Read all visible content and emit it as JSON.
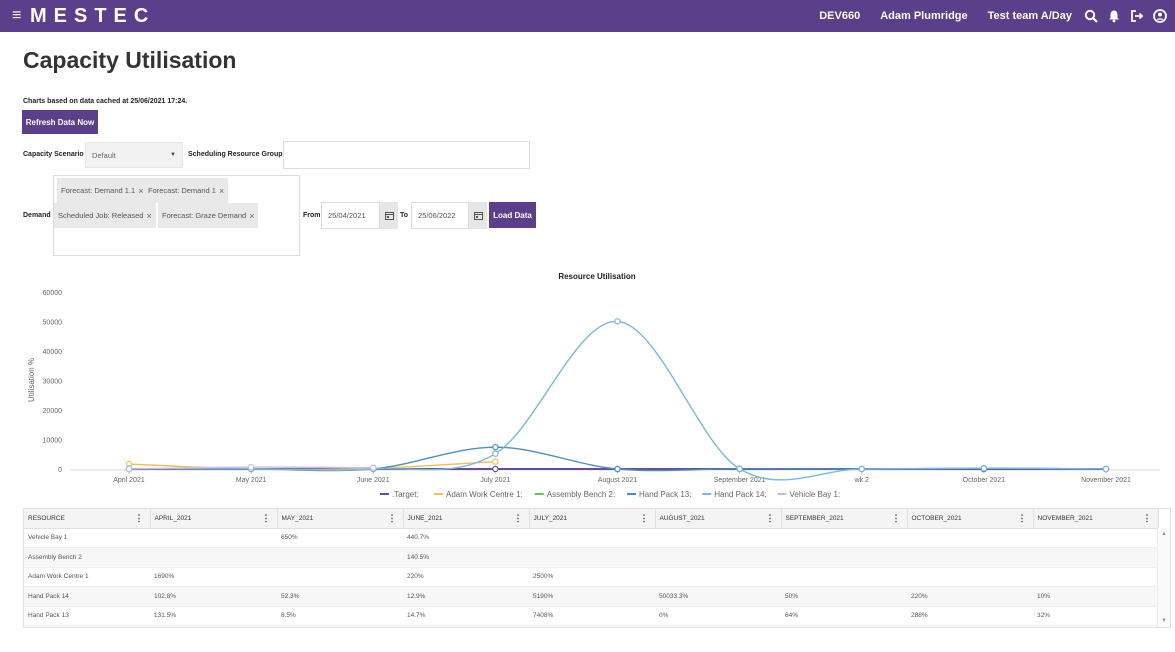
{
  "app": {
    "brand": "MESTEC"
  },
  "topbar": {
    "env": "DEV660",
    "user": "Adam Plumridge",
    "team": "Test team A/Day"
  },
  "page": {
    "title": "Capacity Utilisation",
    "cache_note": "Charts based on data cached at 25/06/2021 17:24.",
    "refresh_label": "Refresh Data Now"
  },
  "filters": {
    "scenario_label": "Capacity Scenario",
    "scenario_value": "Default",
    "resource_group_label": "Scheduling Resource Group",
    "resource_group_value": "",
    "demand_label": "Demand",
    "demand_chips": [
      "Forecast: Demand 1.1",
      "Forecast: Demand 1",
      "Scheduled Job: Released",
      "Forecast: Graze Demand"
    ],
    "from_label": "From",
    "from_value": "25/04/2021",
    "to_label": "To",
    "to_value": "25/06/2022",
    "load_label": "Load Data"
  },
  "chart_data": {
    "type": "line",
    "title": "Resource Utilisation",
    "ylabel": "Utilisation %",
    "xlabel": "",
    "categories": [
      "April 2021",
      "May 2021",
      "June 2021",
      "July 2021",
      "August 2021",
      "September 2021",
      "wk 2",
      "October 2021",
      "November 2021"
    ],
    "ylim": [
      0,
      60000
    ],
    "yticks": [
      0,
      10000,
      20000,
      30000,
      40000,
      50000,
      60000
    ],
    "legend_position": "bottom",
    "series": [
      {
        "name": ".Target:",
        "color": "#6a4c9c",
        "values": [
          0,
          0,
          0,
          0,
          0,
          0,
          0,
          0,
          0
        ]
      },
      {
        "name": "Adam Work Centre 1:",
        "color": "#f0c050",
        "values": [
          1690,
          0,
          220,
          2500,
          null,
          null,
          null,
          null,
          null
        ]
      },
      {
        "name": "Assembly Bench 2:",
        "color": "#6bbf59",
        "values": [
          null,
          null,
          140.5,
          null,
          null,
          null,
          null,
          null,
          null
        ]
      },
      {
        "name": "Hand Pack 13:",
        "color": "#4a90b8",
        "values": [
          131.5,
          8.5,
          14.7,
          7408,
          0,
          64,
          0,
          288,
          32
        ]
      },
      {
        "name": "Hand Pack 14:",
        "color": "#7ab8dc",
        "values": [
          102.8,
          52.3,
          12.9,
          5190,
          50033.3,
          50,
          0,
          220,
          10
        ]
      },
      {
        "name": "Vehicle Bay 1:",
        "color": "#c8bde0",
        "values": [
          0,
          650,
          440.7,
          null,
          null,
          null,
          null,
          null,
          null
        ]
      }
    ]
  },
  "table": {
    "columns": [
      "RESOURCE",
      "APRIL_2021",
      "MAY_2021",
      "JUNE_2021",
      "JULY_2021",
      "AUGUST_2021",
      "SEPTEMBER_2021",
      "OCTOBER_2021",
      "NOVEMBER_2021"
    ],
    "rows": [
      [
        "Vehicle Bay 1",
        "",
        "650%",
        "440.7%",
        "",
        "",
        "",
        "",
        ""
      ],
      [
        "Assembly Bench 2",
        "",
        "",
        "140.5%",
        "",
        "",
        "",
        "",
        ""
      ],
      [
        "Adam Work Centre 1",
        "1690%",
        "",
        "220%",
        "2500%",
        "",
        "",
        "",
        ""
      ],
      [
        "Hand Pack 14",
        "102.8%",
        "52.3%",
        "12.9%",
        "5190%",
        "50033.3%",
        "50%",
        "220%",
        "10%"
      ],
      [
        "Hand Pack 13",
        "131.5%",
        "8.5%",
        "14.7%",
        "7408%",
        "0%",
        "64%",
        "288%",
        "32%"
      ]
    ]
  }
}
